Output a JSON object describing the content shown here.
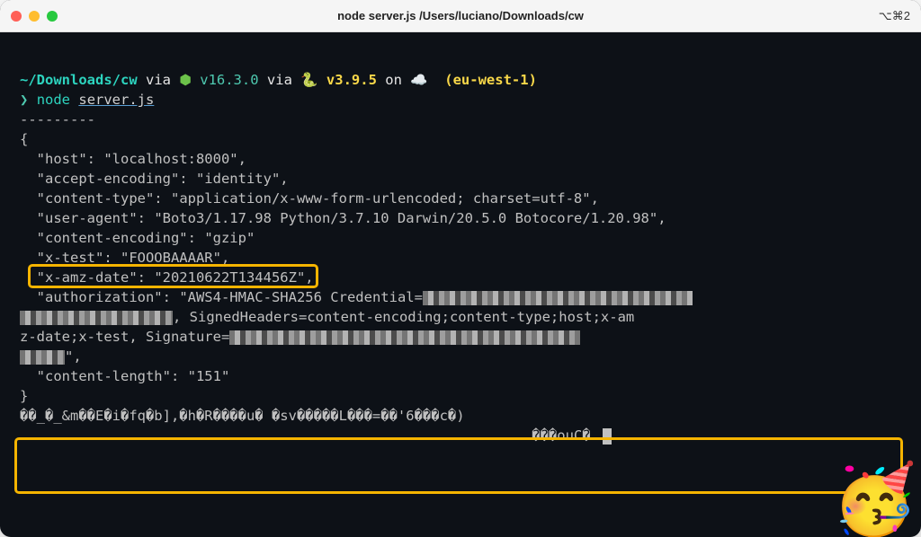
{
  "titlebar": {
    "title": "node server.js /Users/luciano/Downloads/cw",
    "shortcut": "⌥⌘2"
  },
  "prompt": {
    "path": "~/Downloads/cw",
    "via1": "via",
    "node_version": "v16.3.0",
    "via2": "via",
    "python_version": "v3.9.5",
    "on": "on",
    "region": "(eu-west-1)",
    "symbol": "❯",
    "command": "node",
    "arg": "server.js"
  },
  "output": {
    "dashes": "---------",
    "brace_open": "{",
    "host_key": "  \"host\": ",
    "host_val": "\"localhost:8000\",",
    "ae_key": "  \"accept-encoding\": ",
    "ae_val": "\"identity\",",
    "ct_key": "  \"content-type\": ",
    "ct_val": "\"application/x-www-form-urlencoded; charset=utf-8\",",
    "ua_key": "  \"user-agent\": ",
    "ua_val": "\"Boto3/1.17.98 Python/3.7.10 Darwin/20.5.0 Botocore/1.20.98\",",
    "ce_key": "  \"content-encoding\": ",
    "ce_val": "\"gzip\"",
    "xt_key": "  \"x-test\": ",
    "xt_val": "\"FOOOBAAAAR\",",
    "xad_key": "  \"x-amz-date\": ",
    "xad_val": "\"20210622T134456Z\",",
    "auth_key": "  \"authorization\": ",
    "auth_val1": "\"AWS4-HMAC-SHA256 Credential=",
    "auth_val2": ", SignedHeaders=content-encoding;content-type;host;x-am",
    "auth_val3": "z-date;x-test, Signature=",
    "auth_val4": "\",",
    "cl_key": "  \"content-length\": ",
    "cl_val": "\"151\"",
    "brace_close": "}",
    "gzip_line1": "��_�_&m��E�i�fq�b],�h�R����u� �sv�����L���=��'6���c�)",
    "gzip_line2": "                                                             ���ouC�"
  }
}
